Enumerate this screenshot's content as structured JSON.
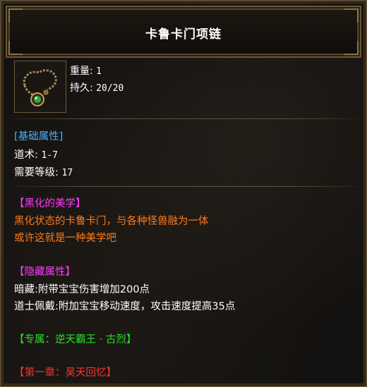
{
  "item": {
    "name": "卡鲁卡门项链",
    "weight_label": "重量:",
    "weight_value": "1",
    "durability_label": "持久:",
    "durability_value": "20/20"
  },
  "base_section": {
    "header": "[基础属性]",
    "rows": [
      {
        "label": "道术:",
        "value": "1-7"
      },
      {
        "label": "需要等级:",
        "value": "17"
      }
    ]
  },
  "blackened_section": {
    "header": "【黑化的美学】",
    "lines": [
      "黑化状态的卡鲁卡门，与各种怪兽融为一体",
      "或许这就是一种美学吧"
    ]
  },
  "hidden_section": {
    "header": "【隐藏属性】",
    "lines": [
      "暗藏:附带宝宝伤害增加200点",
      "道士佩戴:附加宝宝移动速度，攻击速度提高35点"
    ]
  },
  "exclusive": "【专属：逆天霸王 · 古烈】",
  "chapter": "【第一章：昊天回忆】",
  "colors": {
    "frame": "#6a5636",
    "title": "#ffffff",
    "blue": "#4fb0ff",
    "magenta": "#ff3bff",
    "orange": "#ff7a1a",
    "green": "#25e02a",
    "red": "#ff3030"
  },
  "icon": "necklace-icon"
}
